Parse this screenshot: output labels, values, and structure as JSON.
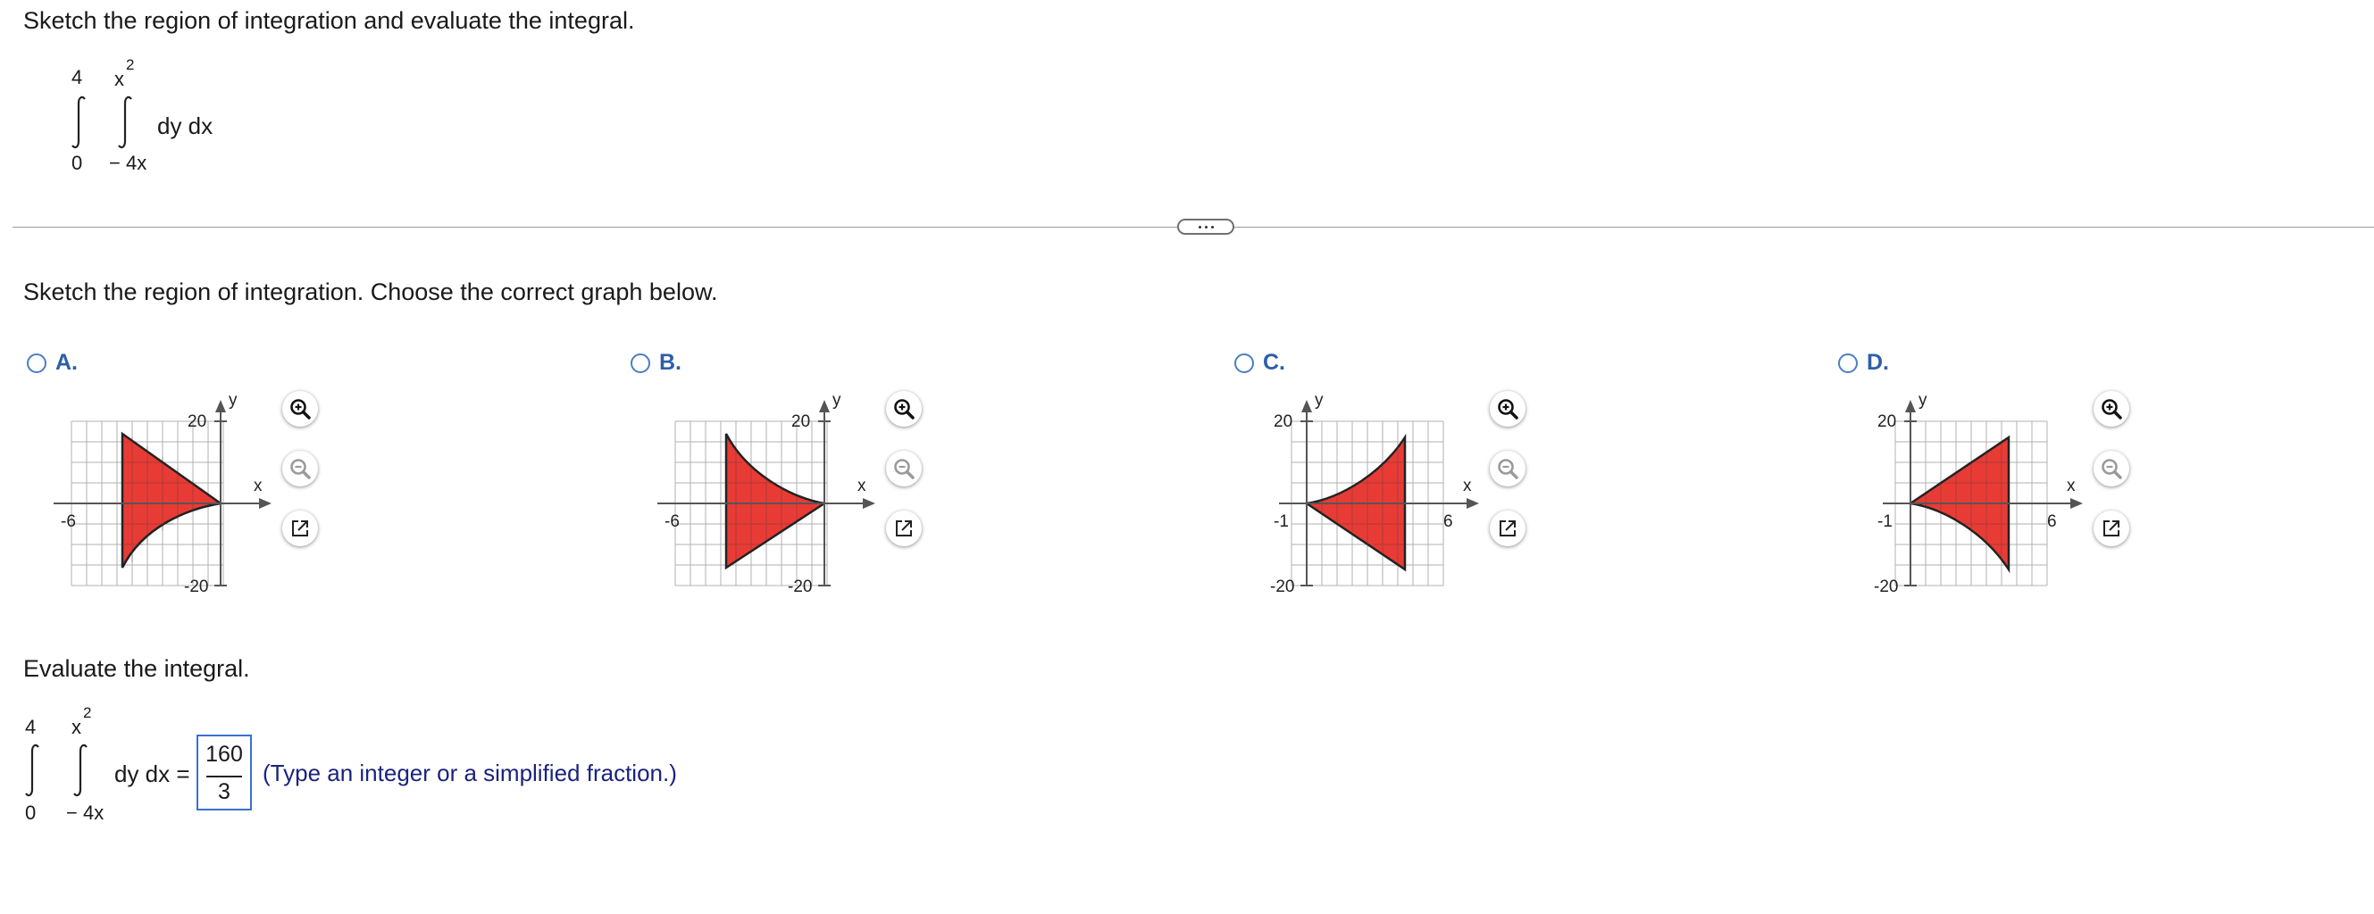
{
  "question": {
    "prompt": "Sketch the region of integration and evaluate the integral.",
    "integral": {
      "outer_upper": "4",
      "outer_lower": "0",
      "inner_upper_base": "x",
      "inner_upper_exp": "2",
      "inner_lower": "− 4x",
      "integrand": "dy dx"
    }
  },
  "more_button_label": "...",
  "part1": {
    "instruction": "Sketch the region of integration. Choose the correct graph below.",
    "options": [
      {
        "letter": "A.",
        "x_label": "x",
        "y_label": "y",
        "y_top": "20",
        "y_bottom": "-20",
        "x_tick": "-6"
      },
      {
        "letter": "B.",
        "x_label": "x",
        "y_label": "y",
        "y_top": "20",
        "y_bottom": "-20",
        "x_tick": "-6"
      },
      {
        "letter": "C.",
        "x_label": "x",
        "y_label": "y",
        "y_top": "20",
        "y_bottom": "-20",
        "x_tick_left": "-1",
        "x_tick_right": "6"
      },
      {
        "letter": "D.",
        "x_label": "x",
        "y_label": "y",
        "y_top": "20",
        "y_bottom": "-20",
        "x_tick_left": "-1",
        "x_tick_right": "6"
      }
    ],
    "tools": [
      "zoom-in-icon",
      "zoom-out-icon",
      "popout-icon"
    ],
    "colors": {
      "region": "#e8302a",
      "radio": "#4a7fc1",
      "label": "#2e5ea8"
    }
  },
  "part2": {
    "instruction": "Evaluate the integral.",
    "equals": "dy dx =",
    "answer_numerator": "160",
    "answer_denominator": "3",
    "hint": "(Type an integer or a simplified fraction.)"
  }
}
